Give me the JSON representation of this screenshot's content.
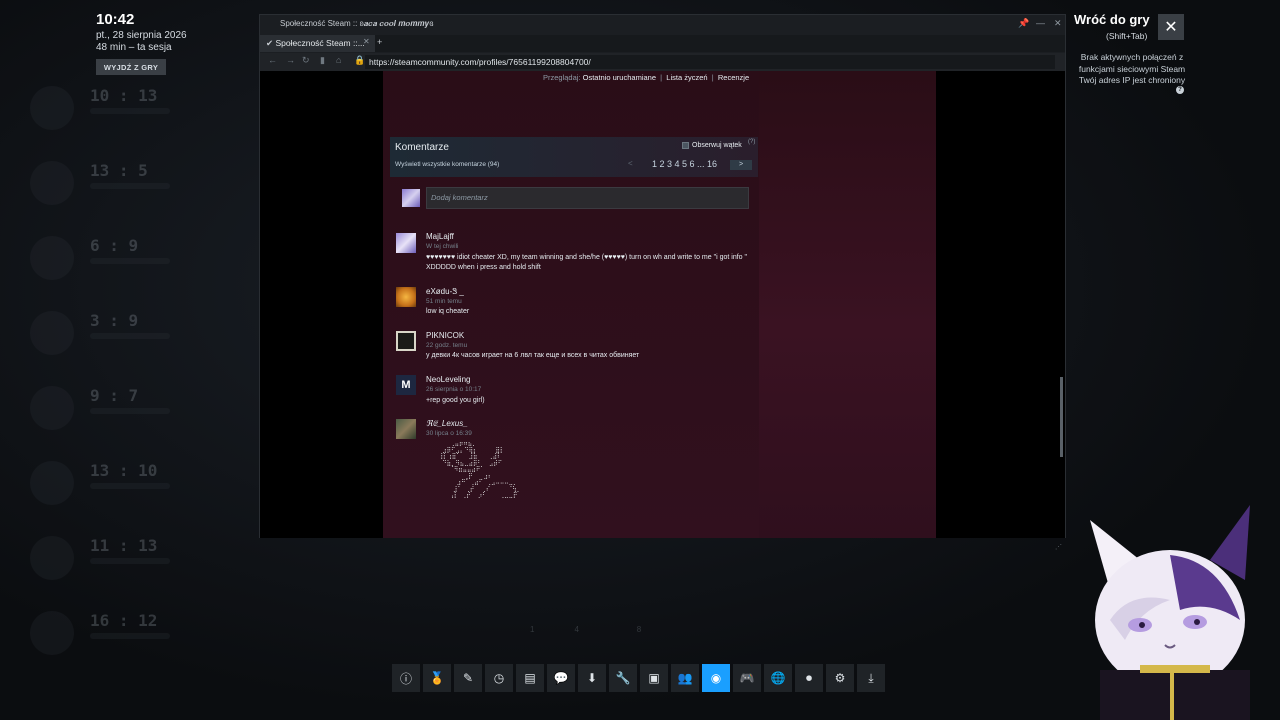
{
  "overlay": {
    "clock": "10:42",
    "date": "pt., 28 sierpnia 2026",
    "session": "48 min – ta sesja",
    "exit_button": "WYJDŹ Z GRY",
    "back_title": "Wróć do gry",
    "back_hint": "(Shift+Tab)",
    "network_status": "Brak aktywnych połączeń z funkcjami sieciowymi Steam Twój adres IP jest chroniony"
  },
  "browser": {
    "window_title": "Społeczność Steam :: ʚ𝒂𝒄𝒂 𝒄𝒐𝒐𝒍 𝒎𝒐𝒎𝒎𝒚ɞ",
    "tab_label": "Społeczność Steam ::...",
    "url": "https://steamcommunity.com/profiles/76561199208804700/"
  },
  "profile": {
    "browse_label": "Przeglądaj:",
    "browse_links": [
      "Ostatnio uruchamiane",
      "Lista życzeń",
      "Recenzje"
    ]
  },
  "comments": {
    "title": "Komentarze",
    "follow_label": "Obserwuj wątek",
    "help": "(?)",
    "view_all": "Wyświetl wszystkie komentarze (94)",
    "pager": "1 2 3 4 5 6 ... 16",
    "next": ">",
    "prev": "<",
    "input_placeholder": "Dodaj komentarz",
    "items": [
      {
        "name": "MajLajff",
        "time": "W tej chwili",
        "text": "♥♥♥♥♥♥♥ idiot cheater XD, my team winning and she/he (♥♥♥♥♥) turn on wh and write to me \"i got info \" XDDDDD when i press and hold shift"
      },
      {
        "name": "eXødu-Ꮥ _",
        "time": "51 min temu",
        "text": "low iq cheater"
      },
      {
        "name": "PIKNICOK",
        "time": "22 godz. temu",
        "text": "у девки 4к часов играет на 6 лвл так еще и всех в читах обвиняет"
      },
      {
        "name": "NeoLeveling",
        "time": "26 sierpnia o 10:17",
        "text": "+rep good you girl)"
      },
      {
        "name": "ℜ𝔈_Lexus_",
        "time": "30 lipca o 16:39",
        "text": ""
      }
    ]
  },
  "background_scores": [
    {
      "score": "10 : 13"
    },
    {
      "score": "13 : 5"
    },
    {
      "score": "6 : 9"
    },
    {
      "score": "3 : 9"
    },
    {
      "score": "9 : 7"
    },
    {
      "score": "13 : 10"
    },
    {
      "score": "11 : 13"
    },
    {
      "score": "16 : 12"
    }
  ],
  "toolbar": [
    "info-icon",
    "achievements-icon",
    "notes-icon",
    "recent-icon",
    "guides-icon",
    "chat-icon",
    "downloads-icon",
    "settings-wrench-icon",
    "screenshots-icon",
    "friends-icon",
    "browser-icon",
    "controller-icon",
    "globe-icon",
    "recording-icon",
    "gear-icon",
    "exit-icon"
  ],
  "colors": {
    "accent": "#1a9fff",
    "profile_bg": "#31101e"
  }
}
